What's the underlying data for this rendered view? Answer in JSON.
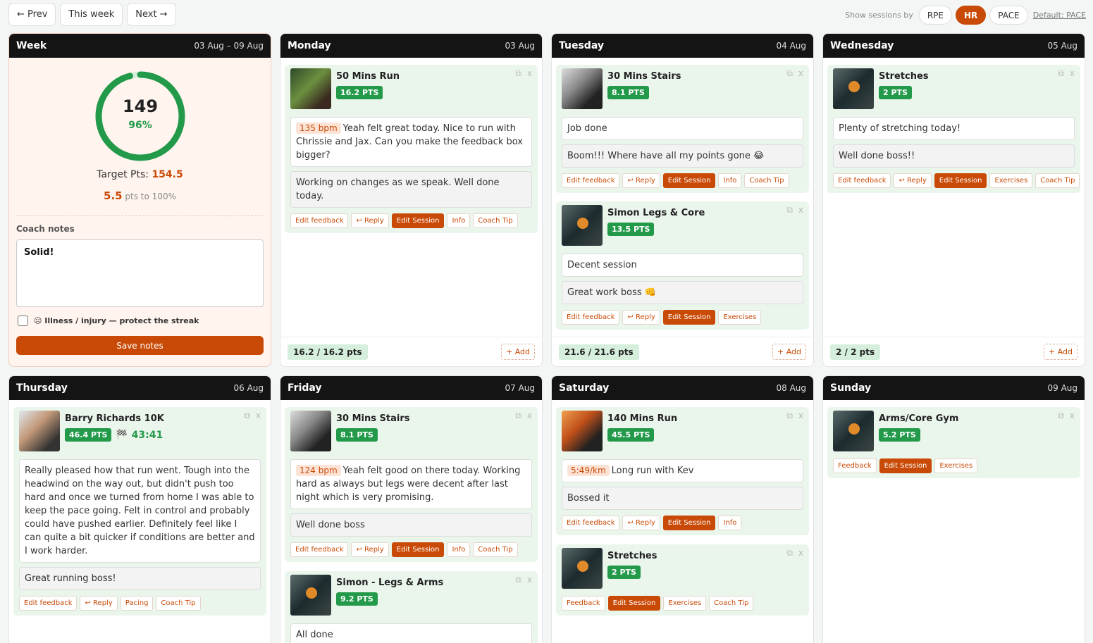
{
  "nav": {
    "prev": "← Prev",
    "this_week": "This week",
    "next": "Next →"
  },
  "show_by": {
    "label": "Show sessions by",
    "options": [
      "RPE",
      "HR",
      "PACE"
    ],
    "selected": "HR",
    "default_link": "Default: PACE"
  },
  "week": {
    "title": "Week",
    "range": "03 Aug – 09 Aug",
    "points": "149",
    "percent": "96%",
    "percent_value": 96,
    "target_label": "Target Pts:",
    "target_value": "154.5",
    "remaining_value": "5.5",
    "remaining_label": "pts to 100%",
    "coach_notes_label": "Coach notes",
    "coach_notes": "Solid!",
    "illness_label": "☹ Illness / injury — protect the streak",
    "save_label": "Save notes"
  },
  "days": {
    "monday": {
      "name": "Monday",
      "date": "03 Aug",
      "total": "16.2 / 16.2 pts",
      "add": "+ Add",
      "s1": {
        "name": "50 Mins Run",
        "pts": "16.2 PTS",
        "metric": "135 bpm",
        "feedback": "Yeah felt great today. Nice to run with Chrissie and Jax. Can you make the feedback box bigger?",
        "reply": "Working on changes as we speak. Well done today.",
        "actions": [
          "Edit feedback",
          "↩ Reply",
          "Edit Session",
          "Info",
          "Coach Tip"
        ]
      }
    },
    "tuesday": {
      "name": "Tuesday",
      "date": "04 Aug",
      "total": "21.6 / 21.6 pts",
      "add": "+ Add",
      "s1": {
        "name": "30 Mins Stairs",
        "pts": "8.1 PTS",
        "feedback": "Job done",
        "reply": "Boom!!! Where have all my points gone 😂",
        "actions": [
          "Edit feedback",
          "↩ Reply",
          "Edit Session",
          "Info",
          "Coach Tip"
        ]
      },
      "s2": {
        "name": "Simon Legs & Core",
        "pts": "13.5 PTS",
        "feedback": "Decent session",
        "reply": "Great work boss 👊",
        "actions": [
          "Edit feedback",
          "↩ Reply",
          "Edit Session",
          "Exercises"
        ]
      }
    },
    "wednesday": {
      "name": "Wednesday",
      "date": "05 Aug",
      "total": "2 / 2 pts",
      "add": "+ Add",
      "s1": {
        "name": "Stretches",
        "pts": "2 PTS",
        "feedback": "Plenty of stretching today!",
        "reply": "Well done boss!!",
        "actions": [
          "Edit feedback",
          "↩ Reply",
          "Edit Session",
          "Exercises",
          "Coach Tip"
        ]
      }
    },
    "thursday": {
      "name": "Thursday",
      "date": "06 Aug",
      "s1": {
        "name": "Barry Richards 10K",
        "pts": "46.4 PTS",
        "flag": "🏁",
        "race_time": "43:41",
        "feedback": "Really pleased how that run went. Tough into the headwind on the way out, but didn't push too hard and once we turned from home I was able to keep the pace going. Felt in control and probably could have pushed earlier. Definitely feel like I can quite a bit quicker if conditions are better and I work harder.",
        "reply": "Great running boss!",
        "actions": [
          "Edit feedback",
          "↩ Reply",
          "Pacing",
          "Coach Tip"
        ]
      }
    },
    "friday": {
      "name": "Friday",
      "date": "07 Aug",
      "s1": {
        "name": "30 Mins Stairs",
        "pts": "8.1 PTS",
        "metric": "124 bpm",
        "feedback": "Yeah felt good on there today. Working hard as always but legs were decent after last night which is very promising.",
        "reply": "Well done boss",
        "actions": [
          "Edit feedback",
          "↩ Reply",
          "Edit Session",
          "Info",
          "Coach Tip"
        ]
      },
      "s2": {
        "name": "Simon - Legs & Arms",
        "pts": "9.2 PTS",
        "feedback": "All done"
      }
    },
    "saturday": {
      "name": "Saturday",
      "date": "08 Aug",
      "s1": {
        "name": "140 Mins Run",
        "pts": "45.5 PTS",
        "metric": "5:49/km",
        "feedback": "Long run with Kev",
        "reply": "Bossed it",
        "actions": [
          "Edit feedback",
          "↩ Reply",
          "Edit Session",
          "Info"
        ]
      },
      "s2": {
        "name": "Stretches",
        "pts": "2 PTS",
        "actions": [
          "Feedback",
          "Edit Session",
          "Exercises",
          "Coach Tip"
        ]
      }
    },
    "sunday": {
      "name": "Sunday",
      "date": "09 Aug",
      "s1": {
        "name": "Arms/Core Gym",
        "pts": "5.2 PTS",
        "actions": [
          "Feedback",
          "Edit Session",
          "Exercises"
        ]
      }
    }
  },
  "icons": {
    "copy": "copy-icon",
    "close": "close-icon"
  },
  "colors": {
    "accent": "#c94a06",
    "success": "#239a4a",
    "header": "#141414"
  }
}
